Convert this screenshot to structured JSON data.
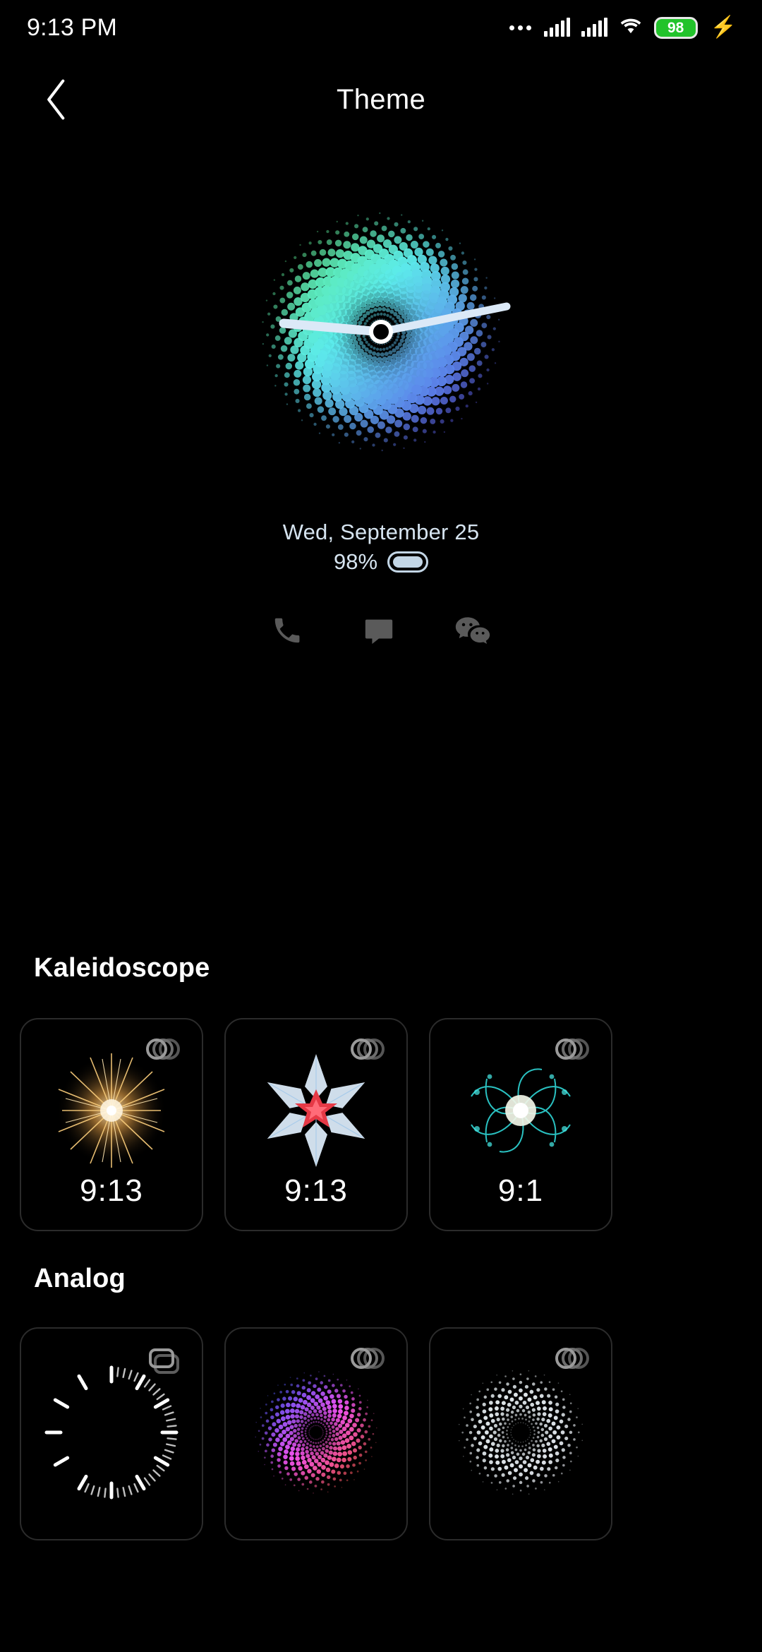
{
  "statusbar": {
    "time": "9:13 PM",
    "battery_percent": "98",
    "icons": [
      "more-dots-icon",
      "signal-bars-icon",
      "signal-bars-icon",
      "wifi-icon",
      "battery-icon",
      "charging-bolt-icon"
    ]
  },
  "header": {
    "title": "Theme",
    "back_icon": "chevron-left-icon"
  },
  "preview": {
    "date": "Wed, September 25",
    "battery_label": "98%",
    "battery_icon": "battery-charging-icon",
    "shortcuts": [
      {
        "name": "phone-shortcut",
        "icon": "phone-icon"
      },
      {
        "name": "messages-shortcut",
        "icon": "message-bubble-icon"
      },
      {
        "name": "wechat-shortcut",
        "icon": "wechat-icon"
      }
    ]
  },
  "sections": [
    {
      "title": "Kaleidoscope",
      "cards": [
        {
          "name": "watchface-kaleidoscope-1",
          "time": "9:13",
          "icon": "style-variants-icon",
          "art": "firework-gold"
        },
        {
          "name": "watchface-kaleidoscope-2",
          "time": "9:13",
          "icon": "style-variants-icon",
          "art": "snowflake-red"
        },
        {
          "name": "watchface-kaleidoscope-3",
          "time": "9:1",
          "icon": "style-variants-icon",
          "art": "flower-teal"
        }
      ]
    },
    {
      "title": "Analog",
      "cards": [
        {
          "name": "watchface-analog-1",
          "time": "",
          "icon": "stacked-cards-icon",
          "art": "tick-dial"
        },
        {
          "name": "watchface-analog-2",
          "time": "",
          "icon": "style-variants-icon",
          "art": "dot-spiral-pink"
        },
        {
          "name": "watchface-analog-3",
          "time": "",
          "icon": "style-variants-icon",
          "art": "dot-ring-white"
        }
      ]
    }
  ],
  "colors": {
    "background": "#000000",
    "card_border": "#2b2b2b",
    "accent_blue": "#6fd3f2",
    "battery_green": "#22c32b",
    "shortcut_gray": "#5a5a5a",
    "preview_text": "#d6e4f0"
  }
}
